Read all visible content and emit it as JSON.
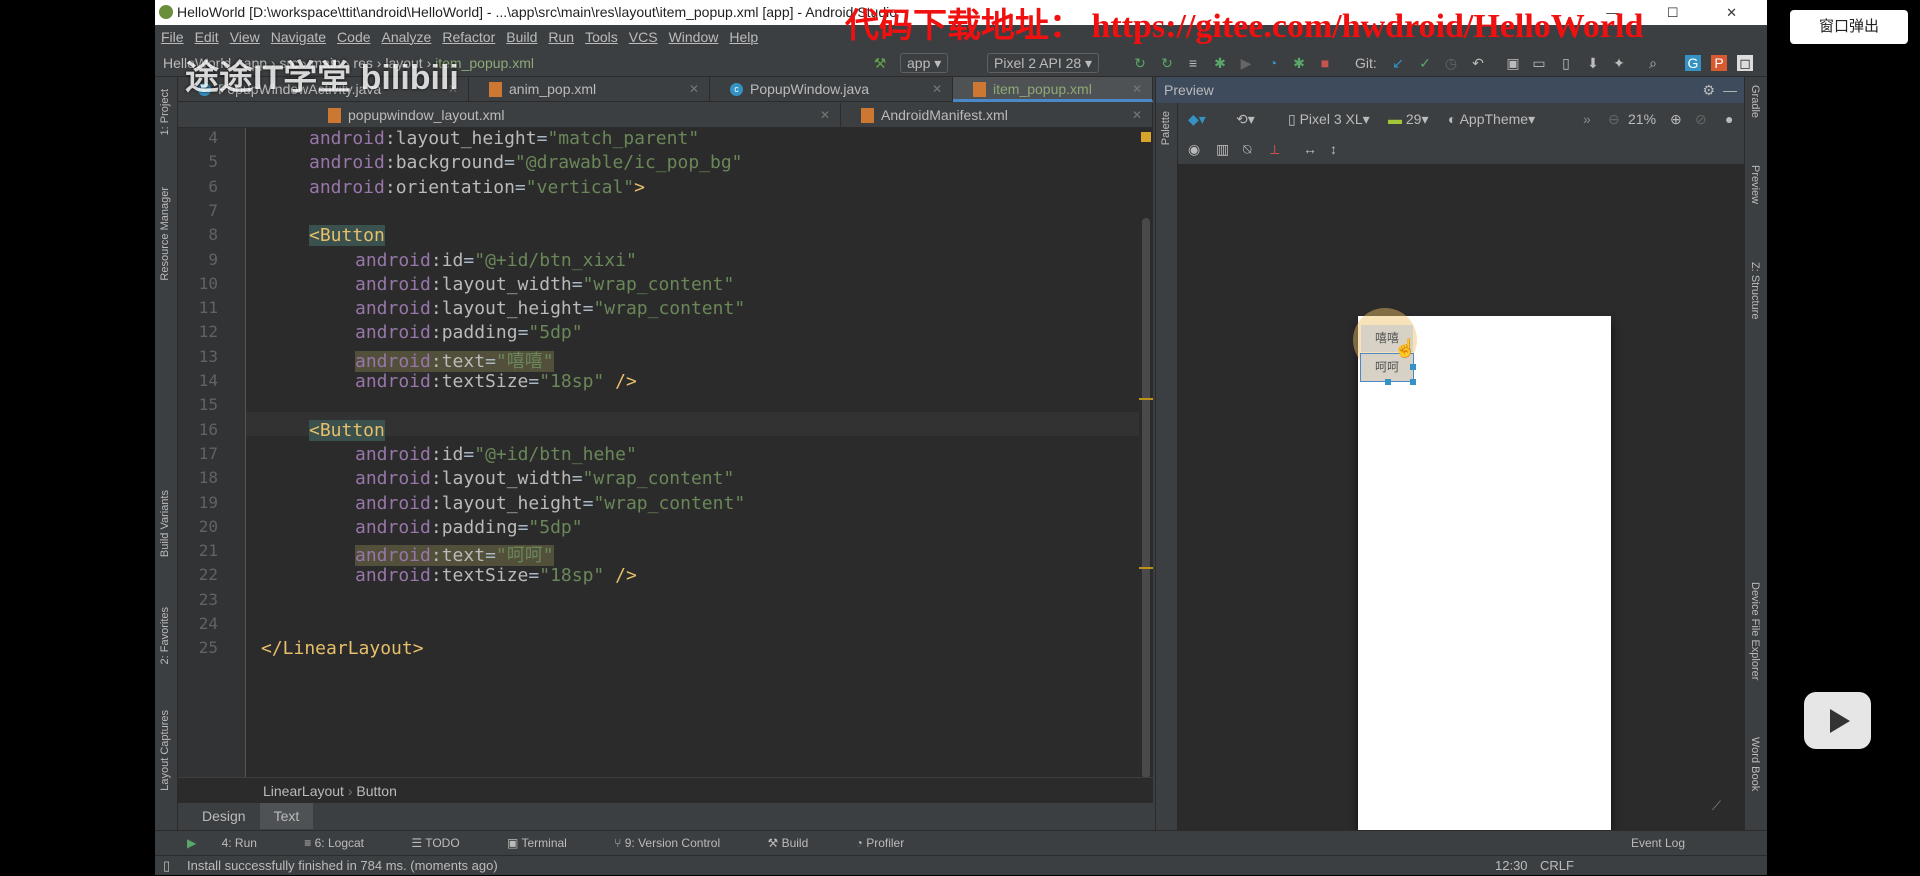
{
  "window": {
    "title": "HelloWorld [D:\\workspace\\ttit\\android\\HelloWorld] - ...\\app\\src\\main\\res\\layout\\item_popup.xml [app] - Android Studio",
    "controls": "— ☐ ✕"
  },
  "menu": [
    "File",
    "Edit",
    "View",
    "Navigate",
    "Code",
    "Analyze",
    "Refactor",
    "Build",
    "Run",
    "Tools",
    "VCS",
    "Window",
    "Help"
  ],
  "breadcrumb_nav": [
    "HelloWorld",
    "app",
    "src",
    "main",
    "res",
    "layout",
    "item_popup.xml"
  ],
  "toolbar": {
    "run_config": "app",
    "device": "Pixel 2 API 28",
    "git_label": "Git:"
  },
  "tabs_row1": [
    {
      "label": "PopupWindowActivity.java",
      "type": "java"
    },
    {
      "label": "anim_pop.xml",
      "type": "xml"
    },
    {
      "label": "PopupWindow.java",
      "type": "java"
    },
    {
      "label": "item_popup.xml",
      "type": "xml",
      "active": true
    }
  ],
  "tabs_row2": [
    {
      "label": "popupwindow_layout.xml",
      "type": "xml"
    },
    {
      "label": "AndroidManifest.xml",
      "type": "xml"
    }
  ],
  "left_strip": [
    "1: Project",
    "Resource Manager",
    "Build Variants",
    "2: Favorites",
    "Layout Captures"
  ],
  "right_strip": [
    "Gradle",
    "Preview",
    "Z: Structure",
    "Device File Explorer",
    "Word Book"
  ],
  "code": [
    {
      "n": "4",
      "ns": "android",
      "attr": "layout_height",
      "val": "\"match_parent\""
    },
    {
      "n": "5",
      "ns": "android",
      "attr": "background",
      "val": "\"@drawable/ic_pop_bg\""
    },
    {
      "n": "6",
      "ns": "android",
      "attr": "orientation",
      "val": "\"vertical\"",
      "end": ">"
    },
    {
      "n": "7"
    },
    {
      "n": "8",
      "tag": "<Button"
    },
    {
      "n": "9",
      "ns": "android",
      "attr": "id",
      "val": "\"@+id/btn_xixi\""
    },
    {
      "n": "10",
      "ns": "android",
      "attr": "layout_width",
      "val": "\"wrap_content\""
    },
    {
      "n": "11",
      "ns": "android",
      "attr": "layout_height",
      "val": "\"wrap_content\""
    },
    {
      "n": "12",
      "ns": "android",
      "attr": "padding",
      "val": "\"5dp\""
    },
    {
      "n": "13",
      "ns": "android",
      "attr": "text",
      "val": "\"嘻嘻\"",
      "mark": true
    },
    {
      "n": "14",
      "ns": "android",
      "attr": "textSize",
      "val": "\"18sp\"",
      "end": " />"
    },
    {
      "n": "15"
    },
    {
      "n": "16",
      "tag": "<Button",
      "current": true
    },
    {
      "n": "17",
      "ns": "android",
      "attr": "id",
      "val": "\"@+id/btn_hehe\""
    },
    {
      "n": "18",
      "ns": "android",
      "attr": "layout_width",
      "val": "\"wrap_content\""
    },
    {
      "n": "19",
      "ns": "android",
      "attr": "layout_height",
      "val": "\"wrap_content\""
    },
    {
      "n": "20",
      "ns": "android",
      "attr": "padding",
      "val": "\"5dp\""
    },
    {
      "n": "21",
      "ns": "android",
      "attr": "text",
      "val": "\"呵呵\"",
      "mark": true
    },
    {
      "n": "22",
      "ns": "android",
      "attr": "textSize",
      "val": "\"18sp\"",
      "end": " />"
    },
    {
      "n": "23"
    },
    {
      "n": "24"
    },
    {
      "n": "25",
      "tag": "</LinearLayout>",
      "outer": true
    }
  ],
  "editor_breadcrumb": [
    "LinearLayout",
    "Button"
  ],
  "design_tabs": [
    "Design",
    "Text"
  ],
  "preview": {
    "title": "Preview",
    "device": "Pixel 3 XL",
    "api": "29",
    "theme": "AppTheme",
    "zoom": "21%",
    "buttons": [
      "嘻嘻",
      "呵呵"
    ],
    "palette": "Palette"
  },
  "tool_windows": [
    "4: Run",
    "6: Logcat",
    "TODO",
    "Terminal",
    "9: Version Control",
    "Build",
    "Profiler"
  ],
  "event_log": "Event Log",
  "status": {
    "message": "Install successfully finished in 784 ms. (moments ago)",
    "position": "12:30",
    "line_sep": "CRLF"
  },
  "overlay": {
    "watermark": "代码下载地址： https://gitee.com/hwdroid/HelloWorld",
    "popout": "窗口弹出",
    "channel_logo": "途途IT学堂 bilibili"
  }
}
